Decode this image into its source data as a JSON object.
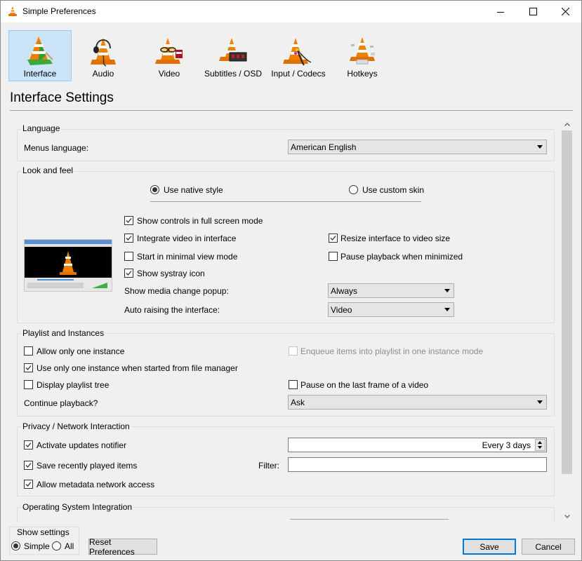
{
  "window": {
    "title": "Simple Preferences",
    "controls": {
      "minimize": "minimize",
      "maximize": "maximize",
      "close": "close"
    }
  },
  "categories": [
    {
      "label": "Interface",
      "icon": "interface-cone-icon",
      "selected": true
    },
    {
      "label": "Audio",
      "icon": "audio-headphones-cone-icon",
      "selected": false
    },
    {
      "label": "Video",
      "icon": "video-glasses-cone-icon",
      "selected": false
    },
    {
      "label": "Subtitles / OSD",
      "icon": "subtitles-display-cone-icon",
      "selected": false
    },
    {
      "label": "Input / Codecs",
      "icon": "input-cables-cone-icon",
      "selected": false
    },
    {
      "label": "Hotkeys",
      "icon": "hotkeys-keyboard-cone-icon",
      "selected": false
    }
  ],
  "page_title": "Interface Settings",
  "language": {
    "group_label": "Language",
    "menus_language_label": "Menus language:",
    "menus_language_value": "American English"
  },
  "look_and_feel": {
    "group_label": "Look and feel",
    "native_style": {
      "label": "Use native style",
      "selected": true
    },
    "custom_skin": {
      "label": "Use custom skin",
      "selected": false
    },
    "show_controls_fullscreen": {
      "label": "Show controls in full screen mode",
      "checked": true
    },
    "integrate_video": {
      "label": "Integrate video in interface",
      "checked": true
    },
    "resize_interface": {
      "label": "Resize interface to video size",
      "checked": true
    },
    "start_minimal": {
      "label": "Start in minimal view mode",
      "checked": false
    },
    "pause_minimized": {
      "label": "Pause playback when minimized",
      "checked": false
    },
    "show_systray": {
      "label": "Show systray icon",
      "checked": true
    },
    "media_change_popup_label": "Show media change popup:",
    "media_change_popup_value": "Always",
    "auto_raising_label": "Auto raising the interface:",
    "auto_raising_value": "Video"
  },
  "playlist": {
    "group_label": "Playlist and Instances",
    "one_instance": {
      "label": "Allow only one instance",
      "checked": false
    },
    "enqueue_items": {
      "label": "Enqueue items into playlist in one instance mode",
      "checked": false,
      "disabled": true
    },
    "one_instance_file_manager": {
      "label": "Use only one instance when started from file manager",
      "checked": true
    },
    "display_tree": {
      "label": "Display playlist tree",
      "checked": false
    },
    "pause_last_frame": {
      "label": "Pause on the last frame of a video",
      "checked": false
    },
    "continue_playback_label": "Continue playback?",
    "continue_playback_value": "Ask"
  },
  "privacy": {
    "group_label": "Privacy / Network Interaction",
    "updates_notifier": {
      "label": "Activate updates notifier",
      "checked": true
    },
    "updates_interval": "Every 3 days",
    "save_recent": {
      "label": "Save recently played items",
      "checked": true
    },
    "filter_label": "Filter:",
    "filter_value": "",
    "metadata_access": {
      "label": "Allow metadata network access",
      "checked": true
    }
  },
  "os_integration": {
    "group_label": "Operating System Integration"
  },
  "footer": {
    "show_settings_label": "Show settings",
    "simple": {
      "label": "Simple",
      "selected": true
    },
    "all": {
      "label": "All",
      "selected": false
    },
    "reset_label": "Reset Preferences",
    "save_label": "Save",
    "cancel_label": "Cancel"
  },
  "colors": {
    "selected_category_bg": "#cce4f7",
    "default_button_border": "#0078d7",
    "vlc_orange": "#f08000"
  }
}
